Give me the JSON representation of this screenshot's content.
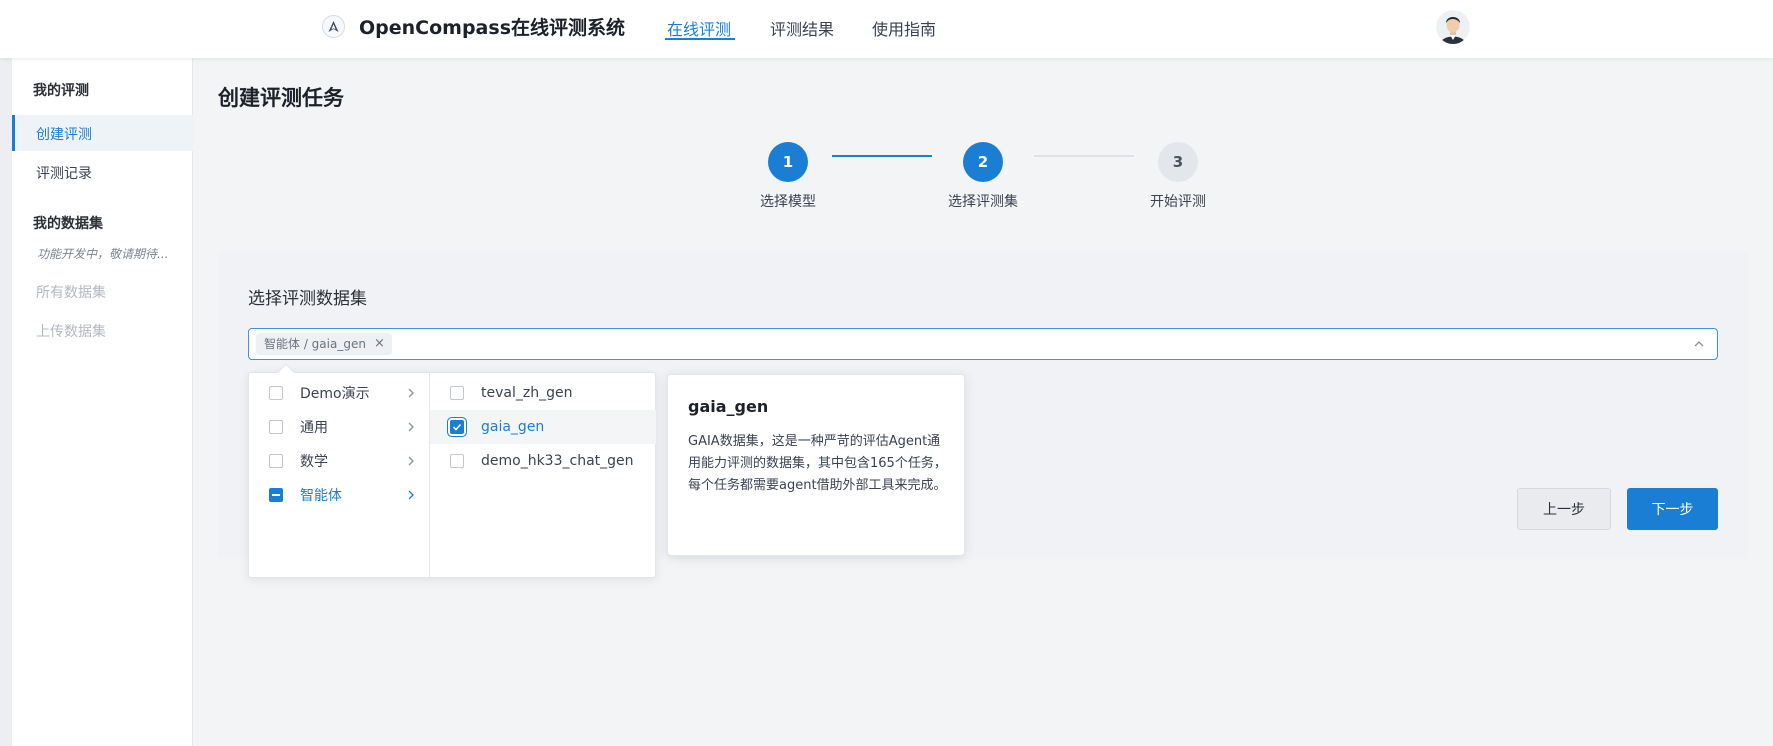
{
  "header": {
    "app_title": "OpenCompass在线评测系统",
    "nav": [
      {
        "label": "在线评测",
        "active": true
      },
      {
        "label": "评测结果",
        "active": false
      },
      {
        "label": "使用指南",
        "active": false
      }
    ],
    "logo_icon": "compass-logo-icon",
    "avatar_icon": "user-avatar-icon"
  },
  "sidebar": {
    "section1_title": "我的评测",
    "items1": [
      {
        "label": "创建评测",
        "active": true
      },
      {
        "label": "评测记录",
        "active": false
      }
    ],
    "section2_title": "我的数据集",
    "note": "功能开发中，敬请期待...",
    "items2": [
      {
        "label": "所有数据集",
        "disabled": true
      },
      {
        "label": "上传数据集",
        "disabled": true
      }
    ]
  },
  "main": {
    "page_title": "创建评测任务",
    "steps": [
      {
        "number": "1",
        "label": "选择模型",
        "status": "done"
      },
      {
        "number": "2",
        "label": "选择评测集",
        "status": "current"
      },
      {
        "number": "3",
        "label": "开始评测",
        "status": "todo"
      }
    ],
    "section_title": "选择评测数据集",
    "cascader": {
      "tag_label": "智能体 / gaia_gen",
      "tag_close": "×"
    },
    "categories": [
      {
        "label": "Demo演示",
        "state": "unchecked"
      },
      {
        "label": "通用",
        "state": "unchecked"
      },
      {
        "label": "数学",
        "state": "unchecked"
      },
      {
        "label": "智能体",
        "state": "indeterminate"
      }
    ],
    "datasets": [
      {
        "label": "teval_zh_gen",
        "checked": false
      },
      {
        "label": "gaia_gen",
        "checked": true
      },
      {
        "label": "demo_hk33_chat_gen",
        "checked": false
      }
    ],
    "popover": {
      "title": "gaia_gen",
      "description": "GAIA数据集，这是一种严苛的评估Agent通用能力评测的数据集，其中包含165个任务，每个任务都需要agent借助外部工具来完成。"
    },
    "buttons": {
      "prev": "上一步",
      "next": "下一步"
    }
  },
  "colors": {
    "accent": "#1a7fd4",
    "background": "#f3f4f6",
    "card": "#f0f2f5"
  }
}
